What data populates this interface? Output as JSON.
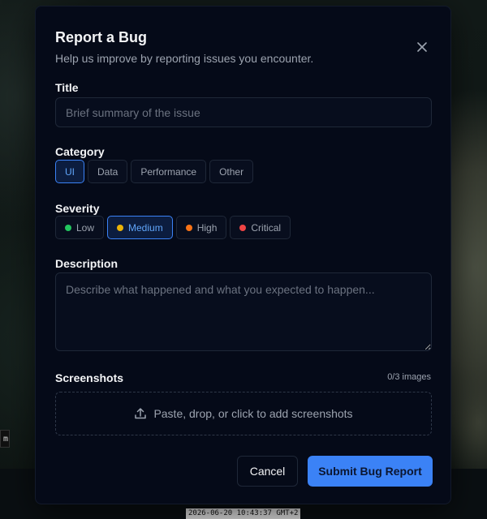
{
  "backdrop": {
    "timestamp": "2026-06-20 10:43:37 GMT+2",
    "scale_label": "m"
  },
  "modal": {
    "title": "Report a Bug",
    "subtitle": "Help us improve by reporting issues you encounter.",
    "close_icon": "close-icon"
  },
  "form": {
    "title": {
      "label": "Title",
      "value": "",
      "placeholder": "Brief summary of the issue"
    },
    "category": {
      "label": "Category",
      "selected": "UI",
      "options": [
        "UI",
        "Data",
        "Performance",
        "Other"
      ]
    },
    "severity": {
      "label": "Severity",
      "selected": "Medium",
      "options": [
        {
          "label": "Low",
          "color": "#22c55e"
        },
        {
          "label": "Medium",
          "color": "#eab308"
        },
        {
          "label": "High",
          "color": "#f97316"
        },
        {
          "label": "Critical",
          "color": "#ef4444"
        }
      ]
    },
    "description": {
      "label": "Description",
      "value": "",
      "placeholder": "Describe what happened and what you expected to happen..."
    },
    "screenshots": {
      "label": "Screenshots",
      "counter": "0/3 images",
      "dropzone_text": "Paste, drop, or click to add screenshots",
      "dropzone_icon": "upload-icon"
    }
  },
  "actions": {
    "cancel_label": "Cancel",
    "submit_label": "Submit Bug Report"
  },
  "colors": {
    "accent": "#3b82f6",
    "modal_bg": "#050a18"
  }
}
